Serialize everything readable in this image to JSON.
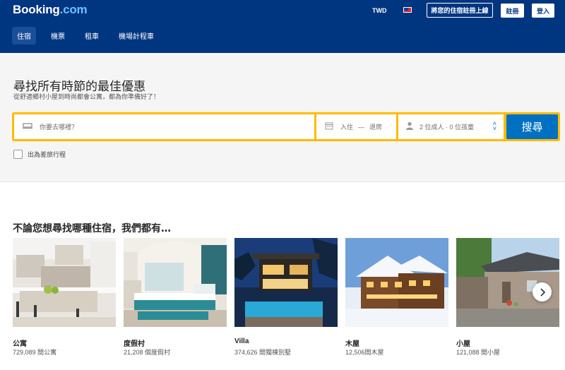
{
  "header": {
    "logo_main": "Booking",
    "logo_dot": ".com",
    "currency": "TWD",
    "list_property": "將您的住宿註冊上線",
    "register": "註冊",
    "sign_in": "登入"
  },
  "nav": {
    "items": [
      "住宿",
      "機票",
      "租車",
      "機場計程車"
    ]
  },
  "hero": {
    "title": "尋找所有時節的最佳優惠",
    "subtitle": "從舒適鄉村小屋到時尚都會公寓，都為你準備好了！"
  },
  "search": {
    "destination_placeholder": "你要去哪裡？",
    "checkin": "入住",
    "dash": "—",
    "checkout": "退房",
    "guests": "2 位成人 · 0 位孩童",
    "button": "搜尋",
    "business_trip": "出為差旅行程"
  },
  "property_types": {
    "title": "不論您想尋找哪種住宿，我們都有…",
    "items": [
      {
        "name": "公寓",
        "count": "729,089 間公寓"
      },
      {
        "name": "度假村",
        "count": "21,208 個度假村"
      },
      {
        "name": "Villa",
        "count": "374,626 間獨棟別墅"
      },
      {
        "name": "木屋",
        "count": "12,506間木屋"
      },
      {
        "name": "小屋",
        "count": "121,088 間小屋"
      }
    ]
  },
  "colors": {
    "brand_blue": "#003580",
    "accent_yellow": "#febb02",
    "button_blue": "#0071c2"
  }
}
